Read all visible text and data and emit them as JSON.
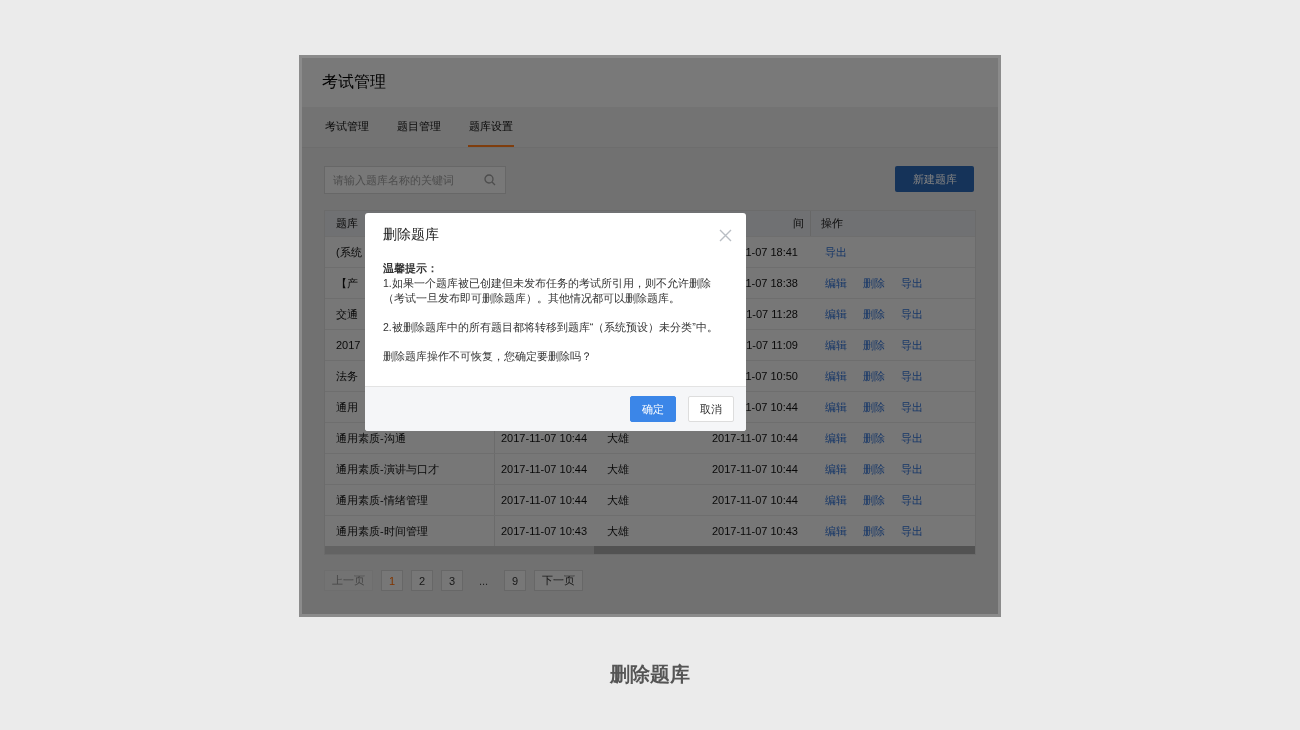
{
  "app": {
    "title": "考试管理",
    "tabs": [
      {
        "label": "考试管理",
        "selected": false
      },
      {
        "label": "题目管理",
        "selected": false
      },
      {
        "label": "题库设置",
        "selected": true
      }
    ],
    "search": {
      "placeholder": "请输入题库名称的关键词"
    },
    "new_button": "新建题库",
    "table": {
      "header": {
        "column_1": "题库",
        "column_4": "间",
        "column_5": "操作"
      },
      "rows": [
        {
          "column_1": "(系统",
          "column_4": "1-07 18:41",
          "actions": [
            "导出"
          ]
        },
        {
          "column_1": "【产",
          "column_4": "1-07 18:38",
          "actions": [
            "编辑",
            "删除",
            "导出"
          ]
        },
        {
          "column_1": "交通",
          "column_4": "1-07 11:28",
          "actions": [
            "编辑",
            "删除",
            "导出"
          ]
        },
        {
          "column_1": "2017",
          "column_4": "1-07 11:09",
          "actions": [
            "编辑",
            "删除",
            "导出"
          ]
        },
        {
          "column_1": "法务",
          "column_4": "1-07 10:50",
          "actions": [
            "编辑",
            "删除",
            "导出"
          ]
        },
        {
          "column_1": "通用",
          "column_4": "1-07 10:44",
          "actions": [
            "编辑",
            "删除",
            "导出"
          ]
        },
        {
          "column_1": "通用素质-沟通",
          "column_2": "2017-11-07 10:44",
          "column_3": "大雄",
          "column_4": "2017-11-07 10:44",
          "actions": [
            "编辑",
            "删除",
            "导出"
          ]
        },
        {
          "column_1": "通用素质-演讲与口才",
          "column_2": "2017-11-07 10:44",
          "column_3": "大雄",
          "column_4": "2017-11-07 10:44",
          "actions": [
            "编辑",
            "删除",
            "导出"
          ]
        },
        {
          "column_1": "通用素质-情绪管理",
          "column_2": "2017-11-07 10:44",
          "column_3": "大雄",
          "column_4": "2017-11-07 10:44",
          "actions": [
            "编辑",
            "删除",
            "导出"
          ]
        },
        {
          "column_1": "通用素质-时间管理",
          "column_2": "2017-11-07 10:43",
          "column_3": "大雄",
          "column_4": "2017-11-07 10:43",
          "actions": [
            "编辑",
            "删除",
            "导出"
          ]
        }
      ]
    },
    "pagination": [
      {
        "kind": "prev",
        "label": "上一页",
        "selected": false,
        "disabled": true
      },
      {
        "kind": "page",
        "label": "1",
        "selected": true,
        "disabled": false
      },
      {
        "kind": "page",
        "label": "2",
        "selected": false,
        "disabled": false
      },
      {
        "kind": "page",
        "label": "3",
        "selected": false,
        "disabled": false
      },
      {
        "kind": "ellipsis",
        "label": "...",
        "selected": false,
        "disabled": false
      },
      {
        "kind": "page",
        "label": "9",
        "selected": false,
        "disabled": false
      },
      {
        "kind": "next",
        "label": "下一页",
        "selected": false,
        "disabled": false
      }
    ]
  },
  "dialog": {
    "open": true,
    "title": "删除题库",
    "heading": "温馨提示：",
    "paragraphs": [
      "1.如果一个题库被已创建但未发布任务的考试所引用，则不允许删除（考试一旦发布即可删除题库）。其他情况都可以删除题库。",
      "2.被删除题库中的所有题目都将转移到题库“（系统预设）未分类”中。",
      "删除题库操作不可恢复，您确定要删除吗？"
    ],
    "buttons": [
      {
        "kind": "primary",
        "label": "确定"
      },
      {
        "kind": "default",
        "label": "取消"
      }
    ]
  },
  "caption": "删除题库"
}
